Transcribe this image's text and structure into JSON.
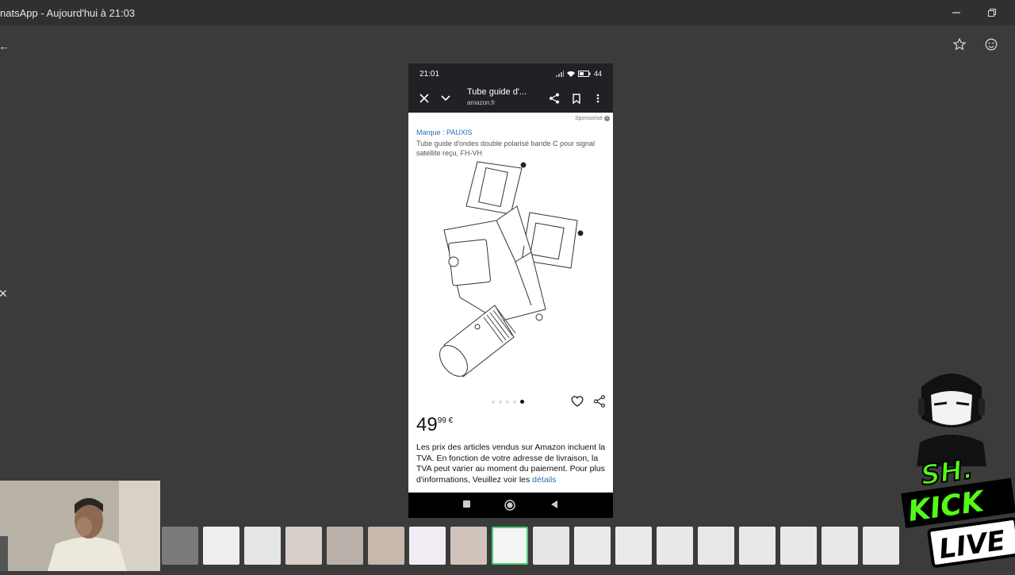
{
  "window": {
    "title": "natsApp - Aujourd'hui à 21:03",
    "minimize_icon": "minimize-icon",
    "restore_icon": "restore-icon"
  },
  "toolbar": {
    "star_icon": "star-icon",
    "emoji_icon": "emoji-icon"
  },
  "phone": {
    "status": {
      "time": "21:01",
      "battery": "44"
    },
    "appbar": {
      "title": "Tube guide d'...",
      "domain": "amazon.fr"
    },
    "sponsored": "Sponsorisé",
    "brand": "Marque : PAUXIS",
    "description": "Tube guide d'ondes double polarisé bande C pour signal satellite reçu, FH-VH",
    "price": {
      "whole": "49",
      "cents": "99 €"
    },
    "tax_text": "Les prix des articles vendus sur Amazon incluent la TVA. En fonction de votre adresse de livraison, la TVA peut varier au moment du paiement. Pour plus d'informations, Veuillez voir les",
    "tax_link": "détails",
    "carousel": {
      "count": 5,
      "active": 5
    }
  },
  "overlay": {
    "kick_line1": "SH.",
    "kick_line2": "KICK",
    "kick_line3": "LIVE"
  },
  "colors": {
    "accent_green": "#41d36b",
    "kick_green": "#53fc18",
    "link_blue": "#2a6eb5"
  }
}
